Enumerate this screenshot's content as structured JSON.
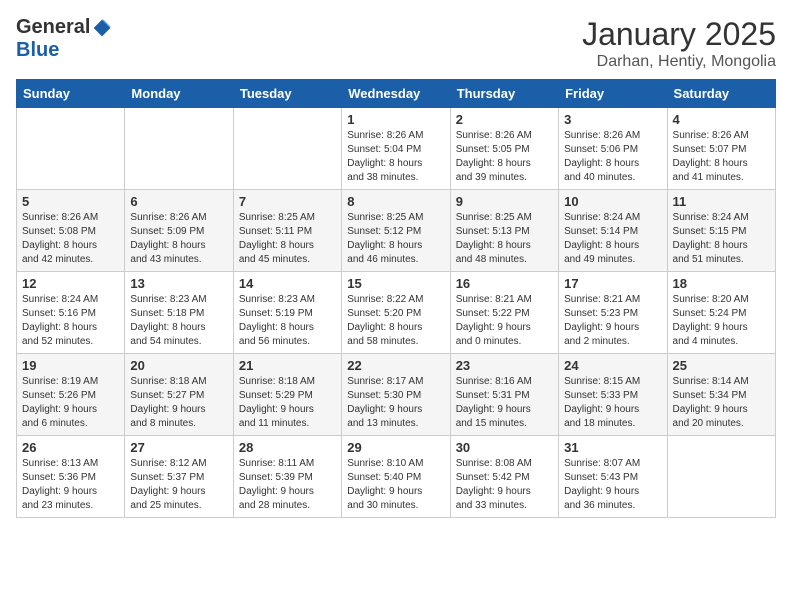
{
  "logo": {
    "general": "General",
    "blue": "Blue"
  },
  "header": {
    "month": "January 2025",
    "location": "Darhan, Hentiy, Mongolia"
  },
  "weekdays": [
    "Sunday",
    "Monday",
    "Tuesday",
    "Wednesday",
    "Thursday",
    "Friday",
    "Saturday"
  ],
  "weeks": [
    [
      {
        "day": "",
        "info": ""
      },
      {
        "day": "",
        "info": ""
      },
      {
        "day": "",
        "info": ""
      },
      {
        "day": "1",
        "info": "Sunrise: 8:26 AM\nSunset: 5:04 PM\nDaylight: 8 hours\nand 38 minutes."
      },
      {
        "day": "2",
        "info": "Sunrise: 8:26 AM\nSunset: 5:05 PM\nDaylight: 8 hours\nand 39 minutes."
      },
      {
        "day": "3",
        "info": "Sunrise: 8:26 AM\nSunset: 5:06 PM\nDaylight: 8 hours\nand 40 minutes."
      },
      {
        "day": "4",
        "info": "Sunrise: 8:26 AM\nSunset: 5:07 PM\nDaylight: 8 hours\nand 41 minutes."
      }
    ],
    [
      {
        "day": "5",
        "info": "Sunrise: 8:26 AM\nSunset: 5:08 PM\nDaylight: 8 hours\nand 42 minutes."
      },
      {
        "day": "6",
        "info": "Sunrise: 8:26 AM\nSunset: 5:09 PM\nDaylight: 8 hours\nand 43 minutes."
      },
      {
        "day": "7",
        "info": "Sunrise: 8:25 AM\nSunset: 5:11 PM\nDaylight: 8 hours\nand 45 minutes."
      },
      {
        "day": "8",
        "info": "Sunrise: 8:25 AM\nSunset: 5:12 PM\nDaylight: 8 hours\nand 46 minutes."
      },
      {
        "day": "9",
        "info": "Sunrise: 8:25 AM\nSunset: 5:13 PM\nDaylight: 8 hours\nand 48 minutes."
      },
      {
        "day": "10",
        "info": "Sunrise: 8:24 AM\nSunset: 5:14 PM\nDaylight: 8 hours\nand 49 minutes."
      },
      {
        "day": "11",
        "info": "Sunrise: 8:24 AM\nSunset: 5:15 PM\nDaylight: 8 hours\nand 51 minutes."
      }
    ],
    [
      {
        "day": "12",
        "info": "Sunrise: 8:24 AM\nSunset: 5:16 PM\nDaylight: 8 hours\nand 52 minutes."
      },
      {
        "day": "13",
        "info": "Sunrise: 8:23 AM\nSunset: 5:18 PM\nDaylight: 8 hours\nand 54 minutes."
      },
      {
        "day": "14",
        "info": "Sunrise: 8:23 AM\nSunset: 5:19 PM\nDaylight: 8 hours\nand 56 minutes."
      },
      {
        "day": "15",
        "info": "Sunrise: 8:22 AM\nSunset: 5:20 PM\nDaylight: 8 hours\nand 58 minutes."
      },
      {
        "day": "16",
        "info": "Sunrise: 8:21 AM\nSunset: 5:22 PM\nDaylight: 9 hours\nand 0 minutes."
      },
      {
        "day": "17",
        "info": "Sunrise: 8:21 AM\nSunset: 5:23 PM\nDaylight: 9 hours\nand 2 minutes."
      },
      {
        "day": "18",
        "info": "Sunrise: 8:20 AM\nSunset: 5:24 PM\nDaylight: 9 hours\nand 4 minutes."
      }
    ],
    [
      {
        "day": "19",
        "info": "Sunrise: 8:19 AM\nSunset: 5:26 PM\nDaylight: 9 hours\nand 6 minutes."
      },
      {
        "day": "20",
        "info": "Sunrise: 8:18 AM\nSunset: 5:27 PM\nDaylight: 9 hours\nand 8 minutes."
      },
      {
        "day": "21",
        "info": "Sunrise: 8:18 AM\nSunset: 5:29 PM\nDaylight: 9 hours\nand 11 minutes."
      },
      {
        "day": "22",
        "info": "Sunrise: 8:17 AM\nSunset: 5:30 PM\nDaylight: 9 hours\nand 13 minutes."
      },
      {
        "day": "23",
        "info": "Sunrise: 8:16 AM\nSunset: 5:31 PM\nDaylight: 9 hours\nand 15 minutes."
      },
      {
        "day": "24",
        "info": "Sunrise: 8:15 AM\nSunset: 5:33 PM\nDaylight: 9 hours\nand 18 minutes."
      },
      {
        "day": "25",
        "info": "Sunrise: 8:14 AM\nSunset: 5:34 PM\nDaylight: 9 hours\nand 20 minutes."
      }
    ],
    [
      {
        "day": "26",
        "info": "Sunrise: 8:13 AM\nSunset: 5:36 PM\nDaylight: 9 hours\nand 23 minutes."
      },
      {
        "day": "27",
        "info": "Sunrise: 8:12 AM\nSunset: 5:37 PM\nDaylight: 9 hours\nand 25 minutes."
      },
      {
        "day": "28",
        "info": "Sunrise: 8:11 AM\nSunset: 5:39 PM\nDaylight: 9 hours\nand 28 minutes."
      },
      {
        "day": "29",
        "info": "Sunrise: 8:10 AM\nSunset: 5:40 PM\nDaylight: 9 hours\nand 30 minutes."
      },
      {
        "day": "30",
        "info": "Sunrise: 8:08 AM\nSunset: 5:42 PM\nDaylight: 9 hours\nand 33 minutes."
      },
      {
        "day": "31",
        "info": "Sunrise: 8:07 AM\nSunset: 5:43 PM\nDaylight: 9 hours\nand 36 minutes."
      },
      {
        "day": "",
        "info": ""
      }
    ]
  ]
}
